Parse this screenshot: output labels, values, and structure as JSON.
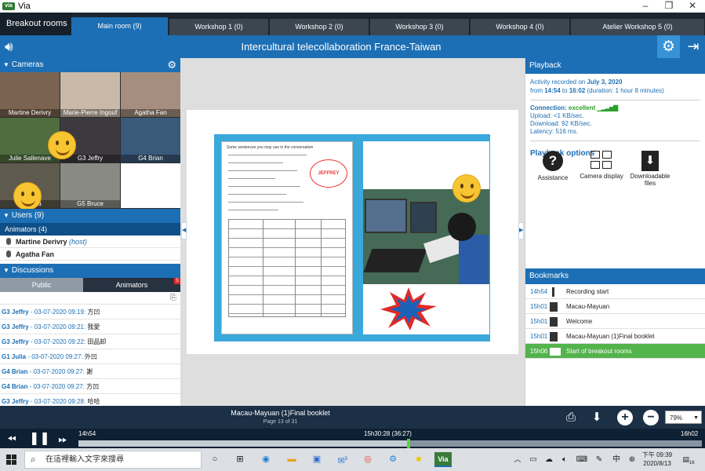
{
  "window": {
    "app_logo": "via",
    "title": "Via"
  },
  "tabs": {
    "breakout_label": "Breakout rooms",
    "items": [
      {
        "label": "Main room (9)"
      },
      {
        "label": "Workshop 1 (0)"
      },
      {
        "label": "Workshop 2 (0)"
      },
      {
        "label": "Workshop 3 (0)"
      },
      {
        "label": "Workshop 4 (0)"
      },
      {
        "label": "Atelier Workshop 5 (0)"
      }
    ]
  },
  "header": {
    "title": "Intercultural telecollaboration France-Taiwan",
    "speaker_icon": "speaker-icon",
    "settings_icon": "gear-icon",
    "exit_icon": "exit-icon"
  },
  "cameras": {
    "label": "Cameras",
    "items": [
      {
        "name": "Martine Derivry",
        "color": "#7a6350"
      },
      {
        "name": "Marie-Pierre Ingouf",
        "color": "#c9b9a8"
      },
      {
        "name": "Agatha Fan",
        "color": "#a58e7e"
      },
      {
        "name": "Julie Sallenave",
        "color": "#4f6d3f"
      },
      {
        "name": "G3 Jeffry",
        "color": "#3c3a3f"
      },
      {
        "name": "G4 Brian",
        "color": "#3a5a7a"
      },
      {
        "name": "G1 Julia",
        "color": "#5f5a4e"
      },
      {
        "name": "G5 Bruce",
        "color": "#8a8a85"
      }
    ]
  },
  "users": {
    "label": "Users (9)",
    "animators_label": "Animators (4)",
    "animators": [
      {
        "name": "Martine Derivry",
        "tag": "(host)"
      },
      {
        "name": "Agatha Fan",
        "tag": ""
      }
    ]
  },
  "discussions": {
    "label": "Discussions",
    "tab_public": "Public",
    "tab_animators": "Animators",
    "badge": "5",
    "messages": [
      {
        "who": "G3 Jeffry",
        "time": " - 03-07-2020 09:19:",
        "text": " 方凹"
      },
      {
        "who": "G3 Jeffry",
        "time": " - 03-07-2020 09:21:",
        "text": " 我愛"
      },
      {
        "who": "G3 Jeffry",
        "time": " - 03-07-2020 09:22:",
        "text": " 田品卸"
      },
      {
        "who": "G1 Julia",
        "time": " - 03-07-2020 09:27:",
        "text": " 外凹"
      },
      {
        "who": "G4 Brian",
        "time": " - 03-07-2020 09:27:",
        "text": " 謝"
      },
      {
        "who": "G4 Brian",
        "time": " - 03-07-2020 09:27:",
        "text": " 方凹"
      },
      {
        "who": "G3 Jeffry",
        "time": " - 03-07-2020 09:28:",
        "text": " 哈哈"
      }
    ]
  },
  "playback": {
    "label": "Playback",
    "recorded_prefix": "Activity recorded on ",
    "recorded_date": "July 3, 2020",
    "from_prefix": "from ",
    "from_time": "14:54",
    "to_word": " to ",
    "to_time": "16:02",
    "duration": " (duration: 1 hour 8 minutes)",
    "connection_label": "Connection: ",
    "connection_value": "excellent",
    "upload": "Upload: <1 KB/sec.",
    "download": "Download: 92 KB/sec.",
    "latency": "Latency: 516 ms.",
    "options_label": "Playback options",
    "options": [
      {
        "label": "Assistance"
      },
      {
        "label": "Camera display"
      },
      {
        "label": "Downloadable files"
      }
    ]
  },
  "bookmarks": {
    "label": "Bookmarks",
    "items": [
      {
        "time": "14h54",
        "label": "Recording start"
      },
      {
        "time": "15h01",
        "label": "Macau-Mayuan"
      },
      {
        "time": "15h01",
        "label": "Welcome"
      },
      {
        "time": "15h01",
        "label": "Macau-Mayuan (1)Final booklet"
      },
      {
        "time": "15h06",
        "label": "Start of breakout rooms"
      }
    ]
  },
  "document": {
    "title": "Macau-Mayuan (1)Final booklet",
    "page": "Page 13 of 31",
    "zoom": "79%",
    "sheet_title": "Some sentences you may use in the conversation",
    "tag": "JEFFREY"
  },
  "timeline": {
    "start": "14h54",
    "current": "15h30:28 (36:27)",
    "end": "16h02",
    "progress": 0.53
  },
  "taskbar": {
    "search_placeholder": "在這裡輸入文字來搜尋",
    "time": "下午 09:39",
    "date": "2020/8/13",
    "ime": "中",
    "notification_count": "16",
    "mail_badge": "5"
  },
  "colors": {
    "accent": "#1c6fb5",
    "active_bookmark": "#53b34c",
    "dark": "#1b2f45"
  }
}
